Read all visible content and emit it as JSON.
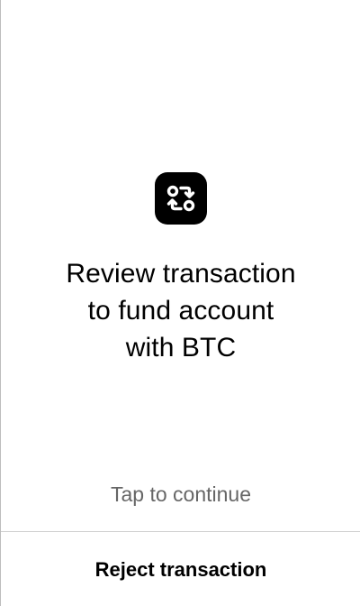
{
  "icon": {
    "name": "swap-transaction-icon"
  },
  "title": {
    "line1": "Review transaction",
    "line2": "to fund account",
    "line3": "with BTC"
  },
  "hint": {
    "text": "Tap to continue"
  },
  "actions": {
    "reject_label": "Reject transaction"
  },
  "colors": {
    "background": "#ffffff",
    "text": "#000000",
    "hint_text": "#666666",
    "divider": "#cfcfcf",
    "icon_tile": "#000000"
  }
}
